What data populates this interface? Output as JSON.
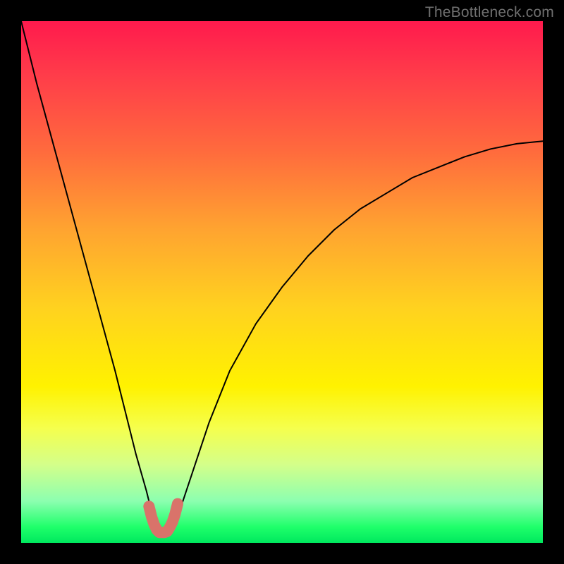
{
  "watermark": "TheBottleneck.com",
  "chart_data": {
    "type": "line",
    "title": "",
    "xlabel": "",
    "ylabel": "",
    "xlim": [
      0,
      100
    ],
    "ylim": [
      0,
      100
    ],
    "grid": false,
    "legend": false,
    "series": [
      {
        "name": "curve",
        "x": [
          0,
          3,
          6,
          9,
          12,
          15,
          18,
          20,
          22,
          24,
          25,
          26,
          27,
          28,
          29,
          30,
          33,
          36,
          40,
          45,
          50,
          55,
          60,
          65,
          70,
          75,
          80,
          85,
          90,
          95,
          100
        ],
        "y": [
          100,
          88,
          77,
          66,
          55,
          44,
          33,
          25,
          17,
          10,
          6,
          3,
          2,
          2,
          3,
          5,
          14,
          23,
          33,
          42,
          49,
          55,
          60,
          64,
          67,
          70,
          72,
          74,
          75.5,
          76.5,
          77
        ]
      },
      {
        "name": "highlight",
        "x": [
          24.5,
          25,
          25.5,
          26,
          26.5,
          27,
          27.5,
          28,
          28.5,
          29,
          29.5,
          30
        ],
        "y": [
          7,
          5,
          3.5,
          2.5,
          2,
          2,
          2,
          2.2,
          3,
          4,
          5.5,
          7.5
        ]
      }
    ],
    "colors": {
      "curve": "#000000",
      "highlight": "#d9736a"
    },
    "background_gradient": [
      "#ff1a4d",
      "#ffa430",
      "#fff200",
      "#00e85e"
    ]
  }
}
